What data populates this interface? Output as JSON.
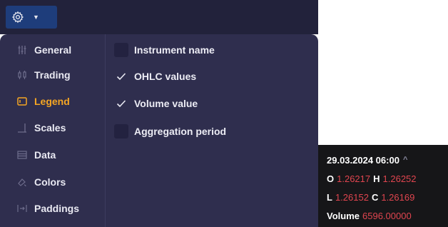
{
  "toolbar": {
    "gear_icon": "gear-icon",
    "caret_icon": "caret-down-icon"
  },
  "sidebar": {
    "items": [
      {
        "label": "General",
        "icon": "sliders-icon",
        "active": false
      },
      {
        "label": "Trading",
        "icon": "candles-icon",
        "active": false
      },
      {
        "label": "Legend",
        "icon": "legend-icon",
        "active": true
      },
      {
        "label": "Scales",
        "icon": "scales-icon",
        "active": false
      },
      {
        "label": "Data",
        "icon": "data-icon",
        "active": false
      },
      {
        "label": "Colors",
        "icon": "colors-icon",
        "active": false
      },
      {
        "label": "Paddings",
        "icon": "paddings-icon",
        "active": false
      }
    ]
  },
  "options": [
    {
      "label": "Instrument name",
      "checked": false
    },
    {
      "label": "OHLC values",
      "checked": true
    },
    {
      "label": "Volume value",
      "checked": true
    },
    {
      "label": "Aggregation period",
      "checked": false
    }
  ],
  "legend": {
    "datetime": "29.03.2024 06:00",
    "expand_symbol": "^",
    "o_label": "O",
    "o_value": "1.26217",
    "h_label": "H",
    "h_value": "1.26252",
    "l_label": "L",
    "l_value": "1.26152",
    "c_label": "C",
    "c_value": "1.26169",
    "volume_label": "Volume",
    "volume_value": "6596.00000"
  },
  "colors": {
    "accent": "#f5a623",
    "panel_bg": "#2f2e4e",
    "toolbar_bg": "#22223b",
    "gear_button_bg": "#1e3d7b",
    "value_red": "#e0454f"
  }
}
